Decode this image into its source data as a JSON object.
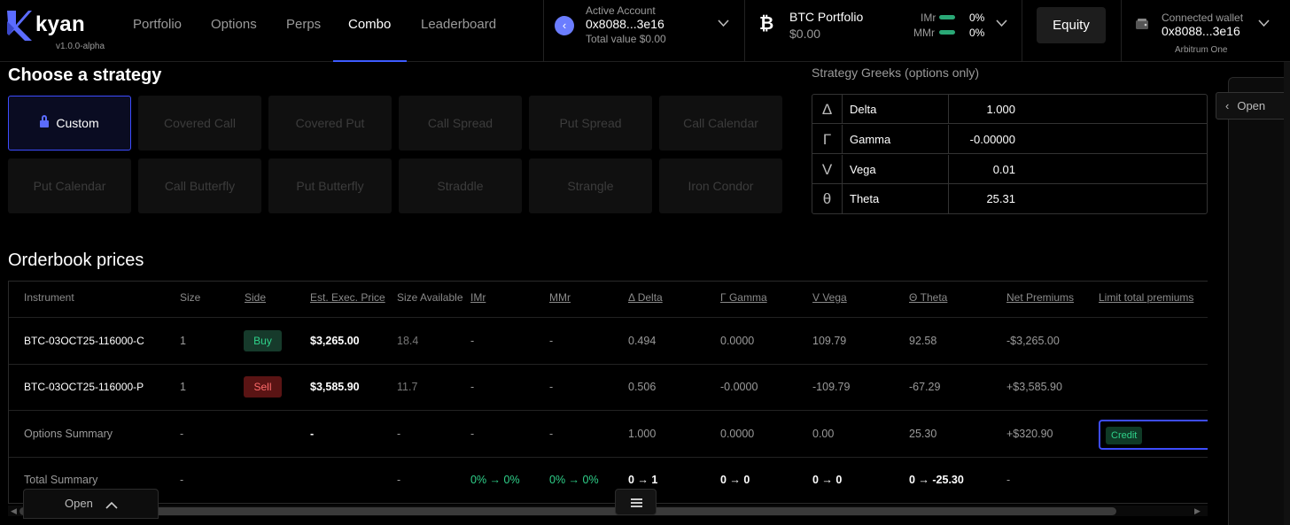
{
  "brand": {
    "name": "kyan",
    "version": "v1.0.0-alpha"
  },
  "nav": {
    "tabs": [
      "Portfolio",
      "Options",
      "Perps",
      "Combo",
      "Leaderboard"
    ],
    "active": "Combo"
  },
  "account": {
    "label": "Active Account",
    "address": "0x8088...3e16",
    "total": "Total value $0.00"
  },
  "portfolio": {
    "title": "BTC Portfolio",
    "value": "$0.00",
    "imr_label": "IMr",
    "imr_value": "0%",
    "mmr_label": "MMr",
    "mmr_value": "0%"
  },
  "equity_button": "Equity",
  "wallet": {
    "label": "Connected wallet",
    "address": "0x8088...3e16",
    "network": "Arbitrum One"
  },
  "strategy": {
    "title": "Choose a strategy",
    "active": "Custom",
    "items": [
      "Custom",
      "Covered Call",
      "Covered Put",
      "Call Spread",
      "Put Spread",
      "Call Calendar",
      "Put Calendar",
      "Call Butterfly",
      "Put Butterfly",
      "Straddle",
      "Strangle",
      "Iron Condor"
    ]
  },
  "greeks": {
    "title": "Strategy Greeks (options only)",
    "rows": [
      {
        "symbol": "Δ",
        "name": "Delta",
        "value": "1.000"
      },
      {
        "symbol": "Γ",
        "name": "Gamma",
        "value": "-0.00000"
      },
      {
        "symbol": "V",
        "name": "Vega",
        "value": "0.01"
      },
      {
        "symbol": "θ",
        "name": "Theta",
        "value": "25.31"
      }
    ]
  },
  "side_panel": {
    "open_label": "Open"
  },
  "orderbook": {
    "title": "Orderbook prices",
    "headers": [
      "Instrument",
      "Size",
      "Side",
      "Est. Exec. Price",
      "Size Available",
      "IMr",
      "MMr",
      "Δ Delta",
      "Γ Gamma",
      "V Vega",
      "Θ Theta",
      "Net Premiums",
      "Limit total premiums"
    ],
    "rows": [
      {
        "instrument": "BTC-03OCT25-116000-C",
        "size": "1",
        "side": "Buy",
        "price": "$3,265.00",
        "avail": "18.4",
        "imr": "-",
        "mmr": "-",
        "delta": "0.494",
        "gamma": "0.0000",
        "vega": "109.79",
        "theta": "92.58",
        "net": "-$3,265.00"
      },
      {
        "instrument": "BTC-03OCT25-116000-P",
        "size": "1",
        "side": "Sell",
        "price": "$3,585.90",
        "avail": "11.7",
        "imr": "-",
        "mmr": "-",
        "delta": "0.506",
        "gamma": "-0.0000",
        "vega": "-109.79",
        "theta": "-67.29",
        "net": "+$3,585.90"
      }
    ],
    "options_summary": {
      "label": "Options Summary",
      "size": "-",
      "price": "-",
      "avail": "-",
      "imr": "-",
      "mmr": "-",
      "delta": "1.000",
      "gamma": "0.0000",
      "vega": "0.00",
      "theta": "25.30",
      "net": "+$320.90",
      "limit_badge": "Credit"
    },
    "total_summary": {
      "label": "Total Summary",
      "size": "-",
      "avail": "-",
      "imr": "0% → 0%",
      "mmr": "0% → 0%",
      "delta": "0 → 1",
      "gamma": "0 → 0",
      "vega": "0 → 0",
      "theta": "0 → -25.30",
      "net": "-"
    }
  },
  "bottom": {
    "open_label": "Open"
  },
  "colors": {
    "accent": "#3d4cff",
    "buy": "#2fd18a",
    "sell": "#ff5a5a",
    "green_text": "#2fd18a"
  }
}
